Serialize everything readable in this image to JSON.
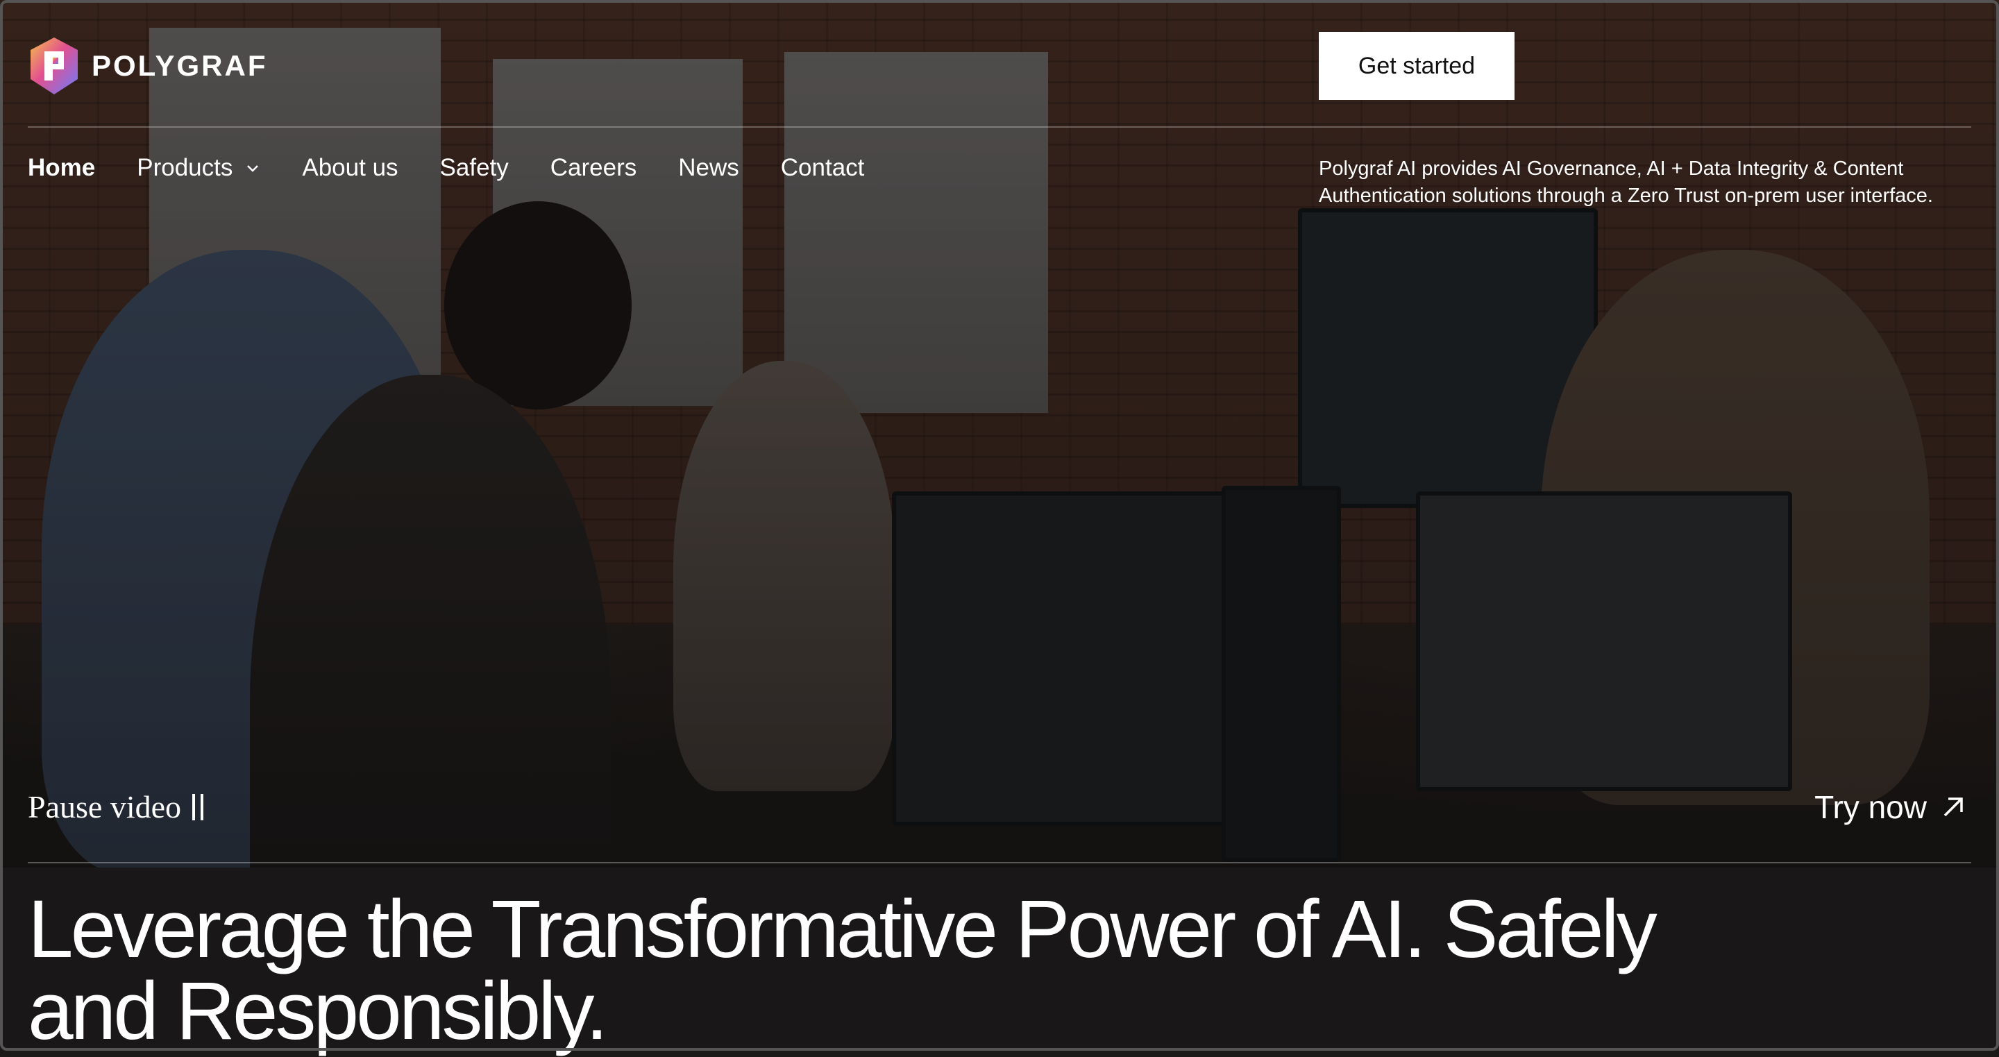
{
  "brand": {
    "name": "POLYGRAF"
  },
  "header": {
    "cta_label": "Get started"
  },
  "nav": {
    "items": [
      {
        "label": "Home",
        "active": true
      },
      {
        "label": "Products",
        "has_dropdown": true
      },
      {
        "label": "About us"
      },
      {
        "label": "Safety"
      },
      {
        "label": "Careers"
      },
      {
        "label": "News"
      },
      {
        "label": "Contact"
      }
    ]
  },
  "tagline": "Polygraf AI provides AI Governance, AI + Data Integrity & Content Authentication solutions through a Zero Trust on-prem user interface.",
  "video": {
    "pause_label": "Pause video",
    "pause_icon": "pause-icon"
  },
  "try_now": {
    "label": "Try now",
    "icon": "arrow-up-right-icon"
  },
  "hero": {
    "headline": "Leverage the Transformative Power of AI. Safely and Responsibly."
  },
  "colors": {
    "cta_bg": "#ffffff",
    "cta_text": "#111111",
    "text": "#ffffff"
  }
}
